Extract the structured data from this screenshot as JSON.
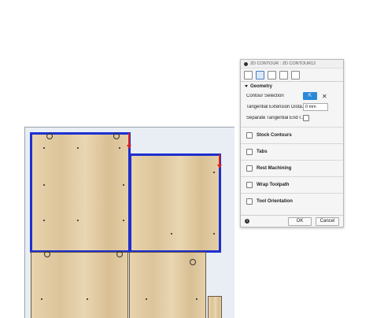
{
  "dialog": {
    "title": "2D CONTOUR : 2D CONTOUR12",
    "tabs": [
      "tool-tab",
      "geometry-tab",
      "heights-tab",
      "passes-tab",
      "linking-tab"
    ],
    "geometry": {
      "heading": "Geometry",
      "contour_selection_label": "Contour Selection",
      "tangential_extension_label": "Tangential Extension Dista...",
      "tangential_extension_value": "0 mm",
      "separate_tangential_label": "Separate Tangential End I..."
    },
    "options": [
      {
        "label": "Stock Contours"
      },
      {
        "label": "Tabs"
      },
      {
        "label": "Rest Machining"
      },
      {
        "label": "Wrap Toolpath"
      },
      {
        "label": "Tool Orientation"
      }
    ],
    "ok_label": "OK",
    "cancel_label": "Cancel"
  },
  "colors": {
    "selection": "#1d2fd0",
    "accent": "#2a88d8",
    "marker": "#e02020"
  }
}
